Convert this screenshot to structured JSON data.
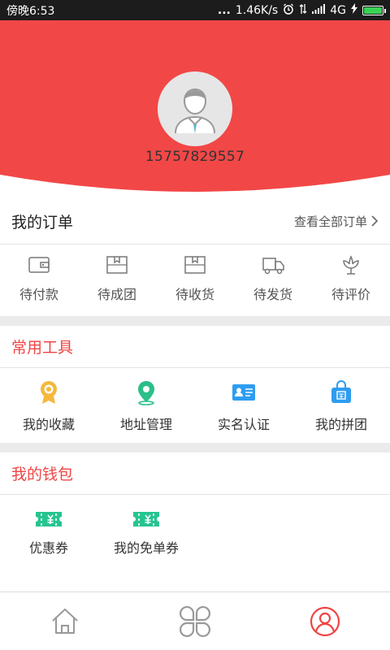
{
  "status_bar": {
    "time": "傍晚6:53",
    "dots": "...",
    "speed": "1.46K/s",
    "network": "4G",
    "battery_level": 1.0
  },
  "profile": {
    "phone": "15757829557",
    "header_color": "#f24747"
  },
  "orders": {
    "title": "我的订单",
    "view_all": "查看全部订单",
    "items": [
      {
        "label": "待付款",
        "icon": "wallet-icon"
      },
      {
        "label": "待成团",
        "icon": "package-icon"
      },
      {
        "label": "待收货",
        "icon": "package-icon"
      },
      {
        "label": "待发货",
        "icon": "truck-icon"
      },
      {
        "label": "待评价",
        "icon": "flower-icon"
      }
    ]
  },
  "tools": {
    "title": "常用工具",
    "items": [
      {
        "label": "我的收藏",
        "icon": "medal-icon"
      },
      {
        "label": "地址管理",
        "icon": "location-icon"
      },
      {
        "label": "实名认证",
        "icon": "id-card-icon"
      },
      {
        "label": "我的拼团",
        "icon": "group-bag-icon"
      }
    ]
  },
  "wallet": {
    "title": "我的钱包",
    "items": [
      {
        "label": "优惠券",
        "icon": "coupon-icon"
      },
      {
        "label": "我的免单券",
        "icon": "coupon-icon"
      }
    ]
  },
  "bottom_nav": [
    {
      "name": "home",
      "icon": "home-icon"
    },
    {
      "name": "categories",
      "icon": "clover-icon"
    },
    {
      "name": "profile",
      "icon": "user-icon",
      "active": true
    }
  ],
  "colors": {
    "accent": "#f04444",
    "tool_yellow": "#f5b83d",
    "tool_green": "#2bbf8a",
    "tool_blue": "#2e9df0",
    "coupon_green": "#26c490"
  }
}
